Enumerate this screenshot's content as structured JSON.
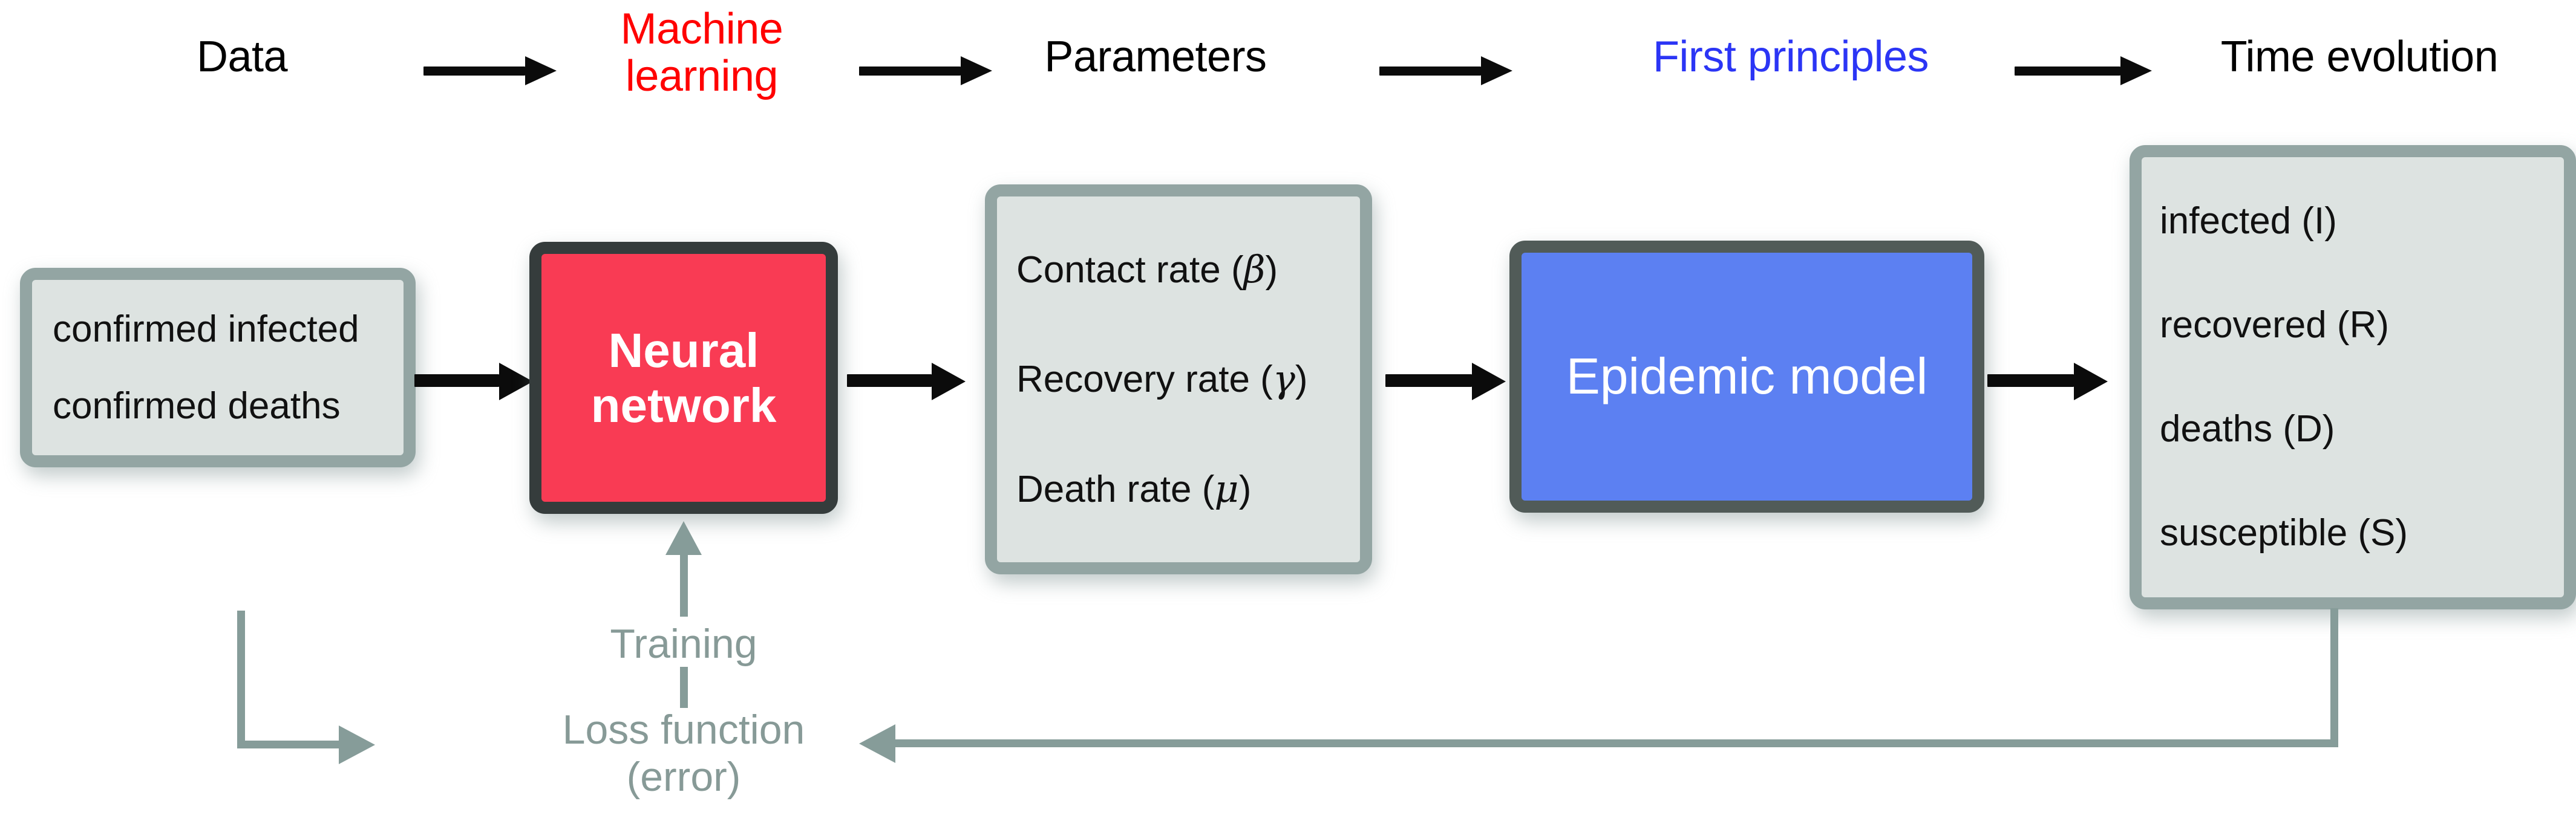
{
  "title": "Epidemic machine-learning pipeline diagram",
  "pipeline": {
    "stage_labels": [
      {
        "text": "Data",
        "color": "#000000"
      },
      {
        "text": "Machine\nlearning",
        "color": "#FF0000"
      },
      {
        "text": "Parameters",
        "color": "#000000"
      },
      {
        "text": "First principles",
        "color": "#2B35F5"
      },
      {
        "text": "Time evolution",
        "color": "#000000"
      }
    ]
  },
  "boxes": {
    "data": {
      "name": "data-box",
      "fill": "#dde3e1",
      "border": "#93a5a3",
      "lines": [
        "confirmed infected",
        "confirmed deaths"
      ]
    },
    "neural_network": {
      "name": "neural-network-box",
      "fill": "#F93B54",
      "border": "#353c3c",
      "title": "Neural\nnetwork"
    },
    "parameters": {
      "name": "parameters-box",
      "fill": "#dde3e1",
      "border": "#93a5a3",
      "lines": [
        "Contact rate (β)",
        "Recovery rate (γ)",
        "Death rate (μ)"
      ],
      "symbols": [
        "β",
        "γ",
        "μ"
      ]
    },
    "epidemic_model": {
      "name": "epidemic-model-box",
      "fill": "#5C80F2",
      "border": "#515b58",
      "title": "Epidemic model"
    },
    "time_evolution": {
      "name": "time-evolution-box",
      "fill": "#dde3e1",
      "border": "#93a5a3",
      "lines": [
        "infected (I)",
        "recovered (R)",
        "deaths (D)",
        "susceptible (S)"
      ]
    }
  },
  "feedback_loop": {
    "color": "#869c99",
    "training_label": "Training",
    "loss_label": "Loss function",
    "loss_label_second_line": "(error)"
  },
  "arrows": {
    "color": "#0b0b0b",
    "count_top": 4,
    "count_between_boxes": 4
  }
}
